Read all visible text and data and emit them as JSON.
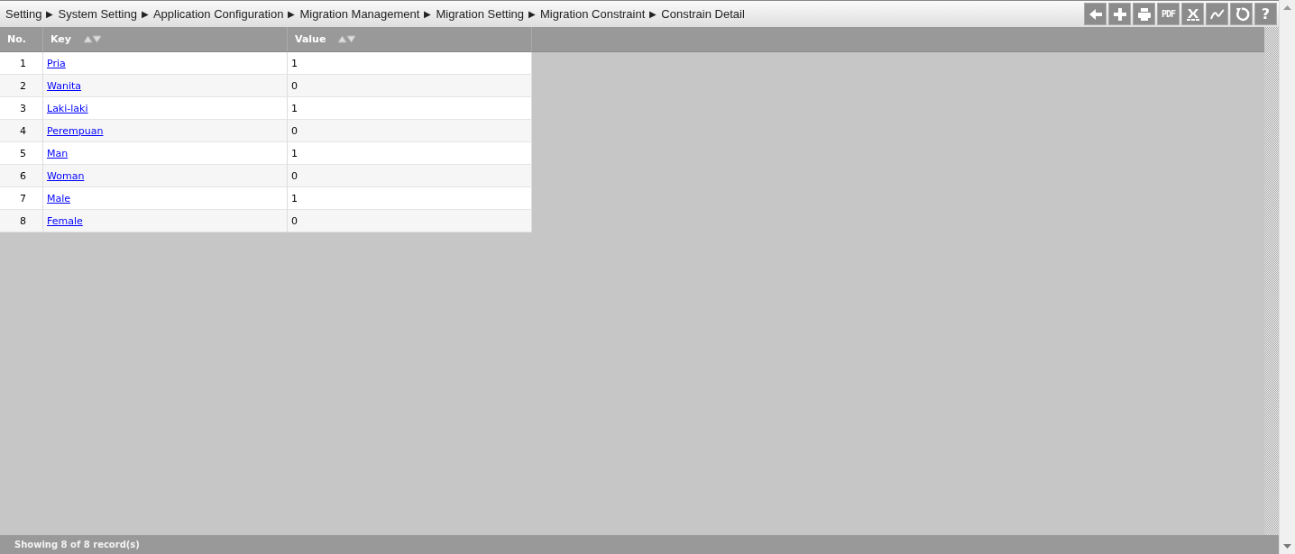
{
  "breadcrumb": [
    {
      "label": "Setting",
      "separator": "▶"
    },
    {
      "label": "System Setting",
      "separator": "▶"
    },
    {
      "label": "Application Configuration",
      "separator": "▶"
    },
    {
      "label": "Migration Management",
      "separator": "▶"
    },
    {
      "label": "Migration Setting",
      "separator": "▶"
    },
    {
      "label": "Migration Constraint",
      "separator": "▶"
    },
    {
      "label": "Constrain Detail"
    }
  ],
  "toolbar": [
    {
      "kind": "back"
    },
    {
      "kind": "add"
    },
    {
      "kind": "print"
    },
    {
      "kind": "pdf",
      "text": "PDF"
    },
    {
      "kind": "export"
    },
    {
      "kind": "chart"
    },
    {
      "kind": "refresh"
    },
    {
      "kind": "help",
      "text": "?"
    }
  ],
  "table": {
    "columns": [
      {
        "label": "No.",
        "sortable": false
      },
      {
        "label": "Key",
        "sortable": true
      },
      {
        "label": "Value",
        "sortable": true
      }
    ],
    "rows": [
      {
        "no": "1",
        "key": "Pria",
        "value": "1"
      },
      {
        "no": "2",
        "key": "Wanita",
        "value": "0"
      },
      {
        "no": "3",
        "key": "Laki-laki",
        "value": "1"
      },
      {
        "no": "4",
        "key": "Perempuan",
        "value": "0"
      },
      {
        "no": "5",
        "key": "Man",
        "value": "1"
      },
      {
        "no": "6",
        "key": "Woman",
        "value": "0"
      },
      {
        "no": "7",
        "key": "Male",
        "value": "1"
      },
      {
        "no": "8",
        "key": "Female",
        "value": "0"
      }
    ]
  },
  "status_bar": {
    "text": "Showing 8 of 8 record(s)"
  }
}
